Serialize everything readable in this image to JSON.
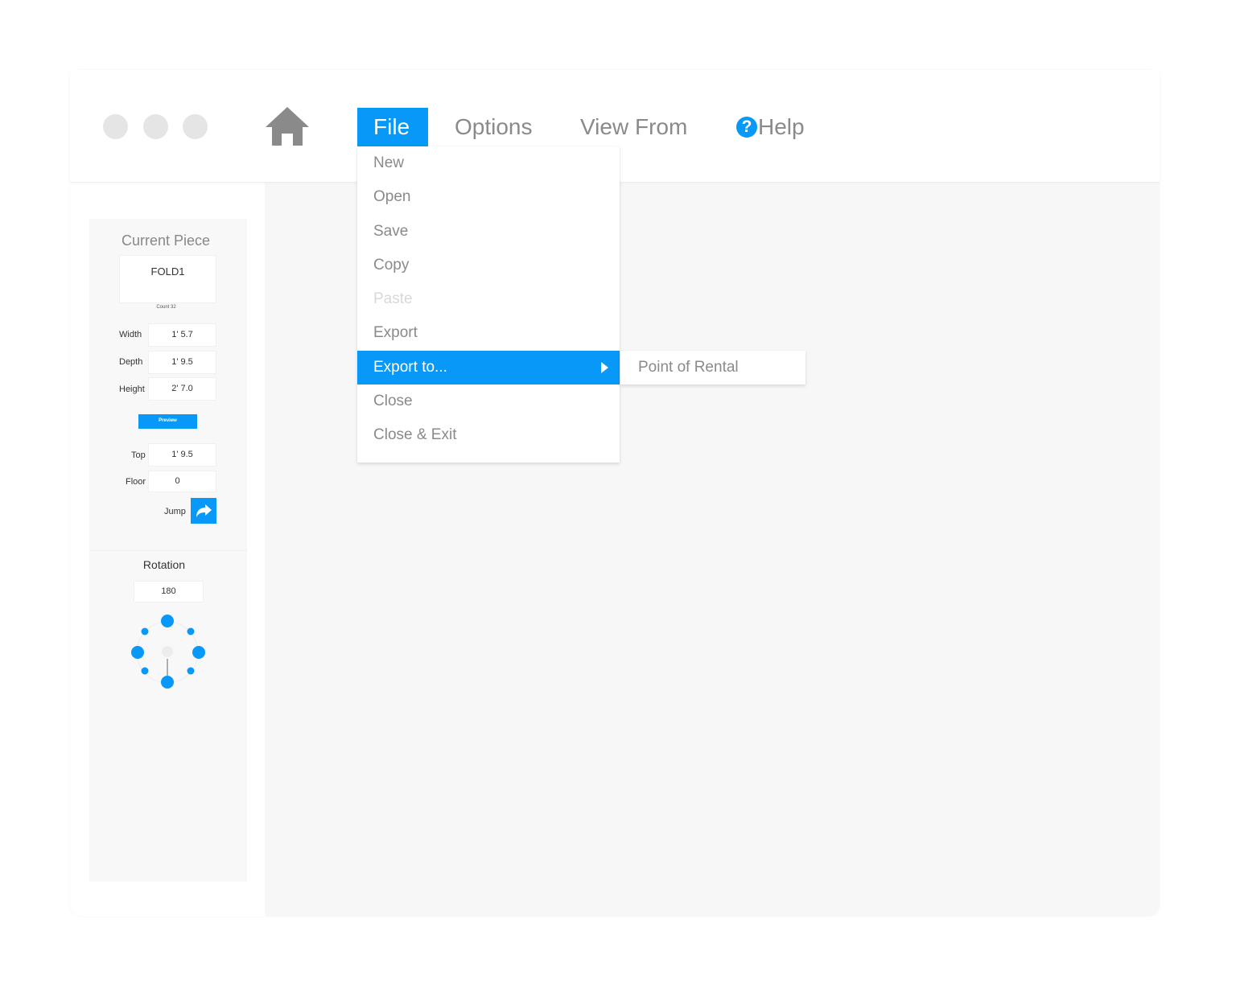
{
  "menubar": {
    "file": "File",
    "options": "Options",
    "view_from": "View From",
    "help": "Help"
  },
  "file_menu": {
    "items": [
      "New",
      "Open",
      "Save",
      "Copy",
      "Paste",
      "Export",
      "Export to...",
      "Close",
      "Close & Exit"
    ],
    "disabled": [
      "Paste"
    ],
    "highlighted": "Export to..."
  },
  "export_submenu": {
    "items": [
      "Point of Rental"
    ]
  },
  "sidebar": {
    "title": "Current Piece",
    "piece_name": "FOLD1",
    "count": "Count 32",
    "width_label": "Width",
    "width_value": "1' 5.7",
    "depth_label": "Depth",
    "depth_value": "1' 9.5",
    "height_label": "Height",
    "height_value": "2' 7.0",
    "preview_label": "Preview",
    "top_label": "Top",
    "top_value": "1' 9.5",
    "floor_label": "Floor",
    "floor_value": "0",
    "jump_label": "Jump",
    "rotation_title": "Rotation",
    "rotation_value": "180"
  },
  "colors": {
    "accent": "#0899f8",
    "menu_text": "#8a8a8a",
    "disabled_text": "#d8d8d8",
    "canvas": "#f7f7f7",
    "window_dot": "#e5e5e5"
  },
  "icons": [
    "home-icon",
    "help-icon",
    "submenu-arrow-icon",
    "jump-arrow-icon",
    "rotation-dial"
  ]
}
